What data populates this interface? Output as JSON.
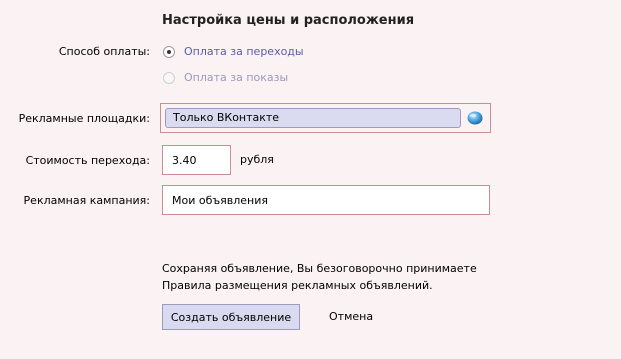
{
  "section_title": "Настройка цены и расположения",
  "payment": {
    "label": "Способ оплаты:",
    "options": [
      {
        "label": "Оплата за переходы",
        "selected": true,
        "enabled": true
      },
      {
        "label": "Оплата за показы",
        "selected": false,
        "enabled": false
      }
    ]
  },
  "platforms": {
    "label": "Рекламные площадки:",
    "selected": "Только ВКонтакте",
    "icon": "globe-icon"
  },
  "cost": {
    "label": "Стоимость перехода:",
    "value": "3.40",
    "unit": "рубля"
  },
  "campaign": {
    "label": "Рекламная кампания:",
    "value": "Мои объявления"
  },
  "notice": {
    "line1": "Сохраняя объявление, Вы безоговорочно принимаете",
    "line2": "Правила размещения рекламных объявлений."
  },
  "actions": {
    "create_label": "Создать объявление",
    "cancel_label": "Отмена"
  },
  "colors": {
    "background": "#fbf3f3",
    "highlight_border": "#c98e8e",
    "button_fill": "#d9d9ef",
    "link_text": "#5b5ba8"
  }
}
